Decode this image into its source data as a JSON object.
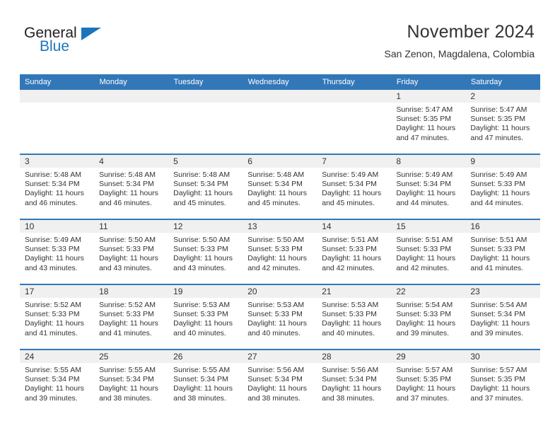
{
  "brand": {
    "name_part1": "General",
    "name_part2": "Blue"
  },
  "header": {
    "title": "November 2024",
    "subtitle": "San Zenon, Magdalena, Colombia"
  },
  "colors": {
    "header_blue": "#3277b8",
    "brand_blue": "#1b75bc",
    "daynum_bg": "#f0f0f0",
    "text": "#333333"
  },
  "weekdays": [
    "Sunday",
    "Monday",
    "Tuesday",
    "Wednesday",
    "Thursday",
    "Friday",
    "Saturday"
  ],
  "weeks": [
    [
      {
        "day": "",
        "empty": true
      },
      {
        "day": "",
        "empty": true
      },
      {
        "day": "",
        "empty": true
      },
      {
        "day": "",
        "empty": true
      },
      {
        "day": "",
        "empty": true
      },
      {
        "day": "1",
        "sunrise": "Sunrise: 5:47 AM",
        "sunset": "Sunset: 5:35 PM",
        "daylight_1": "Daylight: 11 hours",
        "daylight_2": "and 47 minutes."
      },
      {
        "day": "2",
        "sunrise": "Sunrise: 5:47 AM",
        "sunset": "Sunset: 5:35 PM",
        "daylight_1": "Daylight: 11 hours",
        "daylight_2": "and 47 minutes."
      }
    ],
    [
      {
        "day": "3",
        "sunrise": "Sunrise: 5:48 AM",
        "sunset": "Sunset: 5:34 PM",
        "daylight_1": "Daylight: 11 hours",
        "daylight_2": "and 46 minutes."
      },
      {
        "day": "4",
        "sunrise": "Sunrise: 5:48 AM",
        "sunset": "Sunset: 5:34 PM",
        "daylight_1": "Daylight: 11 hours",
        "daylight_2": "and 46 minutes."
      },
      {
        "day": "5",
        "sunrise": "Sunrise: 5:48 AM",
        "sunset": "Sunset: 5:34 PM",
        "daylight_1": "Daylight: 11 hours",
        "daylight_2": "and 45 minutes."
      },
      {
        "day": "6",
        "sunrise": "Sunrise: 5:48 AM",
        "sunset": "Sunset: 5:34 PM",
        "daylight_1": "Daylight: 11 hours",
        "daylight_2": "and 45 minutes."
      },
      {
        "day": "7",
        "sunrise": "Sunrise: 5:49 AM",
        "sunset": "Sunset: 5:34 PM",
        "daylight_1": "Daylight: 11 hours",
        "daylight_2": "and 45 minutes."
      },
      {
        "day": "8",
        "sunrise": "Sunrise: 5:49 AM",
        "sunset": "Sunset: 5:34 PM",
        "daylight_1": "Daylight: 11 hours",
        "daylight_2": "and 44 minutes."
      },
      {
        "day": "9",
        "sunrise": "Sunrise: 5:49 AM",
        "sunset": "Sunset: 5:33 PM",
        "daylight_1": "Daylight: 11 hours",
        "daylight_2": "and 44 minutes."
      }
    ],
    [
      {
        "day": "10",
        "sunrise": "Sunrise: 5:49 AM",
        "sunset": "Sunset: 5:33 PM",
        "daylight_1": "Daylight: 11 hours",
        "daylight_2": "and 43 minutes."
      },
      {
        "day": "11",
        "sunrise": "Sunrise: 5:50 AM",
        "sunset": "Sunset: 5:33 PM",
        "daylight_1": "Daylight: 11 hours",
        "daylight_2": "and 43 minutes."
      },
      {
        "day": "12",
        "sunrise": "Sunrise: 5:50 AM",
        "sunset": "Sunset: 5:33 PM",
        "daylight_1": "Daylight: 11 hours",
        "daylight_2": "and 43 minutes."
      },
      {
        "day": "13",
        "sunrise": "Sunrise: 5:50 AM",
        "sunset": "Sunset: 5:33 PM",
        "daylight_1": "Daylight: 11 hours",
        "daylight_2": "and 42 minutes."
      },
      {
        "day": "14",
        "sunrise": "Sunrise: 5:51 AM",
        "sunset": "Sunset: 5:33 PM",
        "daylight_1": "Daylight: 11 hours",
        "daylight_2": "and 42 minutes."
      },
      {
        "day": "15",
        "sunrise": "Sunrise: 5:51 AM",
        "sunset": "Sunset: 5:33 PM",
        "daylight_1": "Daylight: 11 hours",
        "daylight_2": "and 42 minutes."
      },
      {
        "day": "16",
        "sunrise": "Sunrise: 5:51 AM",
        "sunset": "Sunset: 5:33 PM",
        "daylight_1": "Daylight: 11 hours",
        "daylight_2": "and 41 minutes."
      }
    ],
    [
      {
        "day": "17",
        "sunrise": "Sunrise: 5:52 AM",
        "sunset": "Sunset: 5:33 PM",
        "daylight_1": "Daylight: 11 hours",
        "daylight_2": "and 41 minutes."
      },
      {
        "day": "18",
        "sunrise": "Sunrise: 5:52 AM",
        "sunset": "Sunset: 5:33 PM",
        "daylight_1": "Daylight: 11 hours",
        "daylight_2": "and 41 minutes."
      },
      {
        "day": "19",
        "sunrise": "Sunrise: 5:53 AM",
        "sunset": "Sunset: 5:33 PM",
        "daylight_1": "Daylight: 11 hours",
        "daylight_2": "and 40 minutes."
      },
      {
        "day": "20",
        "sunrise": "Sunrise: 5:53 AM",
        "sunset": "Sunset: 5:33 PM",
        "daylight_1": "Daylight: 11 hours",
        "daylight_2": "and 40 minutes."
      },
      {
        "day": "21",
        "sunrise": "Sunrise: 5:53 AM",
        "sunset": "Sunset: 5:33 PM",
        "daylight_1": "Daylight: 11 hours",
        "daylight_2": "and 40 minutes."
      },
      {
        "day": "22",
        "sunrise": "Sunrise: 5:54 AM",
        "sunset": "Sunset: 5:33 PM",
        "daylight_1": "Daylight: 11 hours",
        "daylight_2": "and 39 minutes."
      },
      {
        "day": "23",
        "sunrise": "Sunrise: 5:54 AM",
        "sunset": "Sunset: 5:34 PM",
        "daylight_1": "Daylight: 11 hours",
        "daylight_2": "and 39 minutes."
      }
    ],
    [
      {
        "day": "24",
        "sunrise": "Sunrise: 5:55 AM",
        "sunset": "Sunset: 5:34 PM",
        "daylight_1": "Daylight: 11 hours",
        "daylight_2": "and 39 minutes."
      },
      {
        "day": "25",
        "sunrise": "Sunrise: 5:55 AM",
        "sunset": "Sunset: 5:34 PM",
        "daylight_1": "Daylight: 11 hours",
        "daylight_2": "and 38 minutes."
      },
      {
        "day": "26",
        "sunrise": "Sunrise: 5:55 AM",
        "sunset": "Sunset: 5:34 PM",
        "daylight_1": "Daylight: 11 hours",
        "daylight_2": "and 38 minutes."
      },
      {
        "day": "27",
        "sunrise": "Sunrise: 5:56 AM",
        "sunset": "Sunset: 5:34 PM",
        "daylight_1": "Daylight: 11 hours",
        "daylight_2": "and 38 minutes."
      },
      {
        "day": "28",
        "sunrise": "Sunrise: 5:56 AM",
        "sunset": "Sunset: 5:34 PM",
        "daylight_1": "Daylight: 11 hours",
        "daylight_2": "and 38 minutes."
      },
      {
        "day": "29",
        "sunrise": "Sunrise: 5:57 AM",
        "sunset": "Sunset: 5:35 PM",
        "daylight_1": "Daylight: 11 hours",
        "daylight_2": "and 37 minutes."
      },
      {
        "day": "30",
        "sunrise": "Sunrise: 5:57 AM",
        "sunset": "Sunset: 5:35 PM",
        "daylight_1": "Daylight: 11 hours",
        "daylight_2": "and 37 minutes."
      }
    ]
  ]
}
